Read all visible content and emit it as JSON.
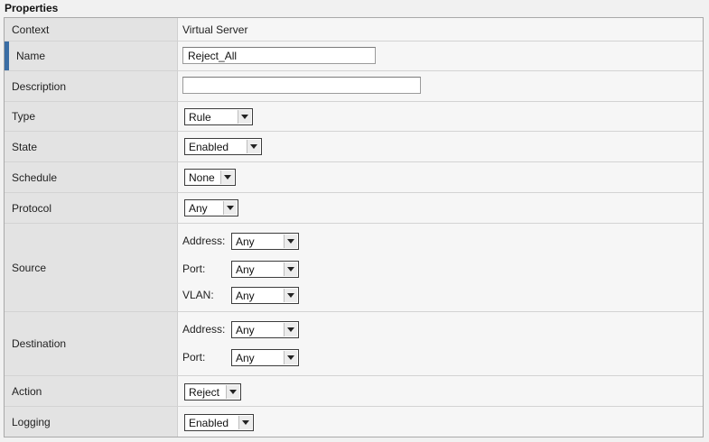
{
  "panel": {
    "title": "Properties"
  },
  "rows": {
    "context": {
      "label": "Context",
      "value": "Virtual Server"
    },
    "name": {
      "label": "Name",
      "value": "Reject_All"
    },
    "description": {
      "label": "Description",
      "value": ""
    },
    "type": {
      "label": "Type",
      "value": "Rule"
    },
    "state": {
      "label": "State",
      "value": "Enabled"
    },
    "schedule": {
      "label": "Schedule",
      "value": "None"
    },
    "protocol": {
      "label": "Protocol",
      "value": "Any"
    },
    "source": {
      "label": "Source",
      "address_label": "Address:",
      "address": "Any",
      "port_label": "Port:",
      "port": "Any",
      "vlan_label": "VLAN:",
      "vlan": "Any"
    },
    "destination": {
      "label": "Destination",
      "address_label": "Address:",
      "address": "Any",
      "port_label": "Port:",
      "port": "Any"
    },
    "action": {
      "label": "Action",
      "value": "Reject"
    },
    "logging": {
      "label": "Logging",
      "value": "Enabled"
    }
  },
  "colors": {
    "required_marker": "#3b6ea5",
    "label_bg": "#e3e3e3",
    "value_bg": "#f6f6f6"
  }
}
